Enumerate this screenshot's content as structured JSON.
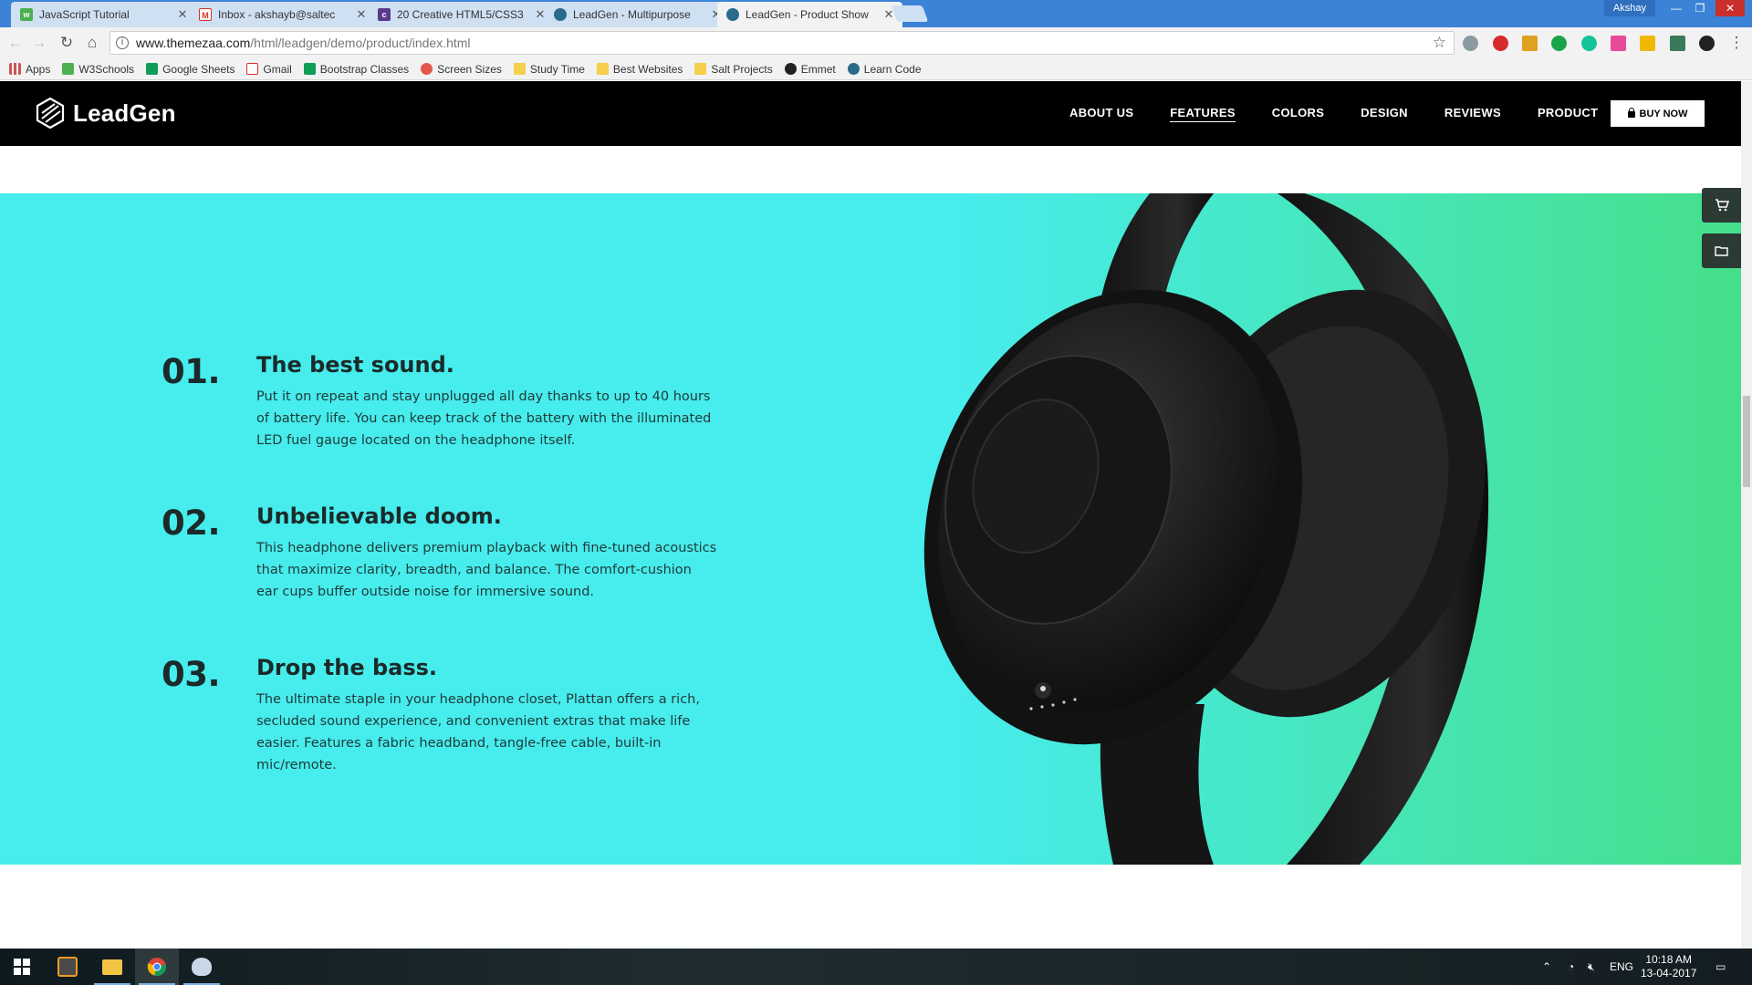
{
  "browser": {
    "tabs": [
      {
        "title": "JavaScript Tutorial",
        "favicon": "w3schools-icon",
        "color": "#4caf50",
        "active": false
      },
      {
        "title": "Inbox - akshayb@saltec",
        "favicon": "gmail-icon",
        "color": "#d93025",
        "active": false
      },
      {
        "title": "20 Creative HTML5/CSS3",
        "favicon": "codrops-icon",
        "color": "#5b3a8c",
        "active": false
      },
      {
        "title": "LeadGen - Multipurpose",
        "favicon": "leadgen-icon",
        "color": "#2a6b8c",
        "active": false
      },
      {
        "title": "LeadGen - Product Show",
        "favicon": "leadgen-icon",
        "color": "#2a6b8c",
        "active": true
      }
    ],
    "profile_name": "Akshay",
    "url_host": "www.themezaa.com",
    "url_path": "/html/leadgen/demo/product/index.html",
    "extensions": [
      "recycle-icon",
      "adblock-icon",
      "ruler-icon",
      "evernote-icon",
      "grammarly-icon",
      "pink-ext-icon",
      "star-ext-icon",
      "vue-icon",
      "dark-ext-icon"
    ],
    "bookmarks": [
      {
        "label": "Apps",
        "icon": "apps-grid-icon"
      },
      {
        "label": "W3Schools",
        "icon": "w3schools-icon"
      },
      {
        "label": "Google Sheets",
        "icon": "sheets-icon"
      },
      {
        "label": "Gmail",
        "icon": "gmail-icon"
      },
      {
        "label": "Bootstrap Classes",
        "icon": "sheets-icon"
      },
      {
        "label": "Screen Sizes",
        "icon": "gear-ext-icon"
      },
      {
        "label": "Study Time",
        "icon": "folder-icon"
      },
      {
        "label": "Best Websites",
        "icon": "folder-icon"
      },
      {
        "label": "Salt Projects",
        "icon": "folder-icon"
      },
      {
        "label": "Emmet",
        "icon": "emmet-icon"
      },
      {
        "label": "Learn Code",
        "icon": "leadgen-icon"
      }
    ]
  },
  "site": {
    "logo_text": "LeadGen",
    "nav": [
      {
        "label": "ABOUT US",
        "active": false
      },
      {
        "label": "FEATURES",
        "active": true
      },
      {
        "label": "COLORS",
        "active": false
      },
      {
        "label": "DESIGN",
        "active": false
      },
      {
        "label": "REVIEWS",
        "active": false
      },
      {
        "label": "PRODUCT",
        "active": false
      }
    ],
    "buy_now": "BUY NOW",
    "features": [
      {
        "number": "01.",
        "title": "The best sound.",
        "description": "Put it on repeat and stay unplugged all day thanks to up to 40 hours of battery life. You can keep track of the battery with the illuminated LED fuel gauge located on the headphone itself."
      },
      {
        "number": "02.",
        "title": "Unbelievable doom.",
        "description": "This headphone delivers premium playback with fine-tuned acoustics that maximize clarity, breadth, and balance. The comfort-cushion ear cups buffer outside noise for immersive sound."
      },
      {
        "number": "03.",
        "title": "Drop the bass.",
        "description": "The ultimate staple in your headphone closet, Plattan offers a rich, secluded sound experience, and convenient extras that make life easier. Features a fabric headband, tangle-free cable, built-in mic/remote."
      }
    ],
    "colors": {
      "section_bg_start": "#47ecec",
      "section_bg_end": "#45df8a",
      "header_bg": "#000000"
    }
  },
  "taskbar": {
    "language": "ENG",
    "time": "10:18 AM",
    "date": "13-04-2017"
  }
}
